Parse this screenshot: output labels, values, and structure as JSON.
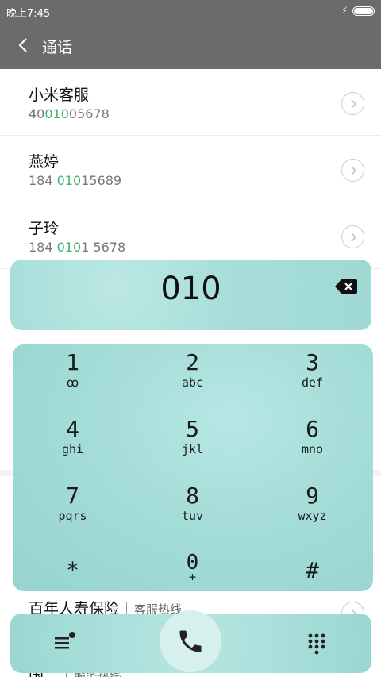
{
  "status_bar": {
    "time": "晚上7:45"
  },
  "header": {
    "title": "通话"
  },
  "contacts": [
    {
      "name": "小米客服",
      "number_prefix": "40",
      "number_match": "010",
      "number_suffix": "05678"
    },
    {
      "name": "燕婷",
      "number_prefix": "184 ",
      "number_match": "010",
      "number_suffix": "15689"
    },
    {
      "name": "子玲",
      "number_prefix": "184 ",
      "number_match": "010",
      "number_suffix": "1 5678"
    }
  ],
  "bottom_contacts": [
    {
      "name": "百年人寿保险",
      "tag": "客服热线"
    },
    {
      "name": "国…",
      "tag": "服务热线"
    }
  ],
  "dialer": {
    "input": "010"
  },
  "keypad": [
    {
      "digit": "1",
      "letters": "ꝏ"
    },
    {
      "digit": "2",
      "letters": "abc"
    },
    {
      "digit": "3",
      "letters": "def"
    },
    {
      "digit": "4",
      "letters": "ghi"
    },
    {
      "digit": "5",
      "letters": "jkl"
    },
    {
      "digit": "6",
      "letters": "mno"
    },
    {
      "digit": "7",
      "letters": "pqrs"
    },
    {
      "digit": "8",
      "letters": "tuv"
    },
    {
      "digit": "9",
      "letters": "wxyz"
    },
    {
      "digit": "*",
      "letters": ""
    },
    {
      "digit": "0",
      "letters": "+"
    },
    {
      "digit": "#",
      "letters": ""
    }
  ],
  "colors": {
    "header_bg": "#6b6b6b",
    "accent_teal": "#a4dcd8",
    "match_green": "#3cb371"
  }
}
